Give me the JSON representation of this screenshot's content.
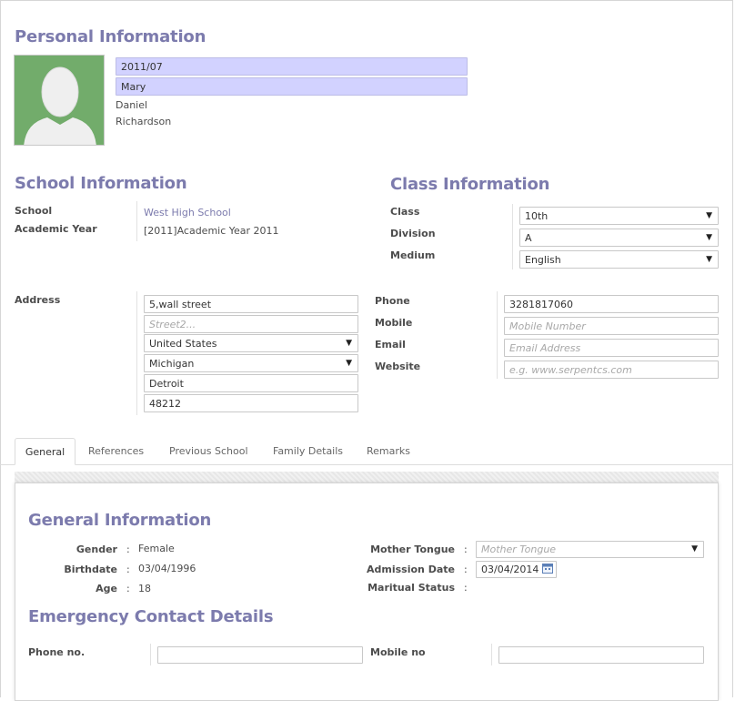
{
  "personal": {
    "title": "Personal Information",
    "photo_icon": "user-avatar-placeholder",
    "student_code": "2011/07",
    "first_name": "Mary",
    "middle_name": "Daniel",
    "last_name": "Richardson"
  },
  "school": {
    "title": "School Information",
    "school_label": "School",
    "school_value": "West High School",
    "year_label": "Academic Year",
    "year_value": "[2011]Academic Year 2011"
  },
  "class_info": {
    "title": "Class Information",
    "class_label": "Class",
    "class_value": "10th",
    "division_label": "Division",
    "division_value": "A",
    "medium_label": "Medium",
    "medium_value": "English"
  },
  "address": {
    "label": "Address",
    "street": "5,wall street",
    "street2_placeholder": "Street2...",
    "country": "United States",
    "state": "Michigan",
    "city": "Detroit",
    "zip": "48212"
  },
  "contact": {
    "phone_label": "Phone",
    "phone_value": "3281817060",
    "mobile_label": "Mobile",
    "mobile_placeholder": "Mobile Number",
    "email_label": "Email",
    "email_placeholder": "Email Address",
    "website_label": "Website",
    "website_placeholder": "e.g. www.serpentcs.com"
  },
  "tabs": [
    {
      "label": "General"
    },
    {
      "label": "References"
    },
    {
      "label": "Previous School"
    },
    {
      "label": "Family Details"
    },
    {
      "label": "Remarks"
    }
  ],
  "general": {
    "title": "General Information",
    "gender_label": "Gender",
    "gender_value": "Female",
    "birthdate_label": "Birthdate",
    "birthdate_value": "03/04/1996",
    "age_label": "Age",
    "age_value": "18",
    "mother_tongue_label": "Mother Tongue",
    "mother_tongue_placeholder": "Mother Tongue",
    "admission_label": "Admission Date",
    "admission_value": "03/04/2014",
    "marital_label": "Maritual Status",
    "colon": ":"
  },
  "emergency": {
    "title": "Emergency Contact Details",
    "phone_label": "Phone no.",
    "mobile_label": "Mobile no"
  },
  "colors": {
    "accent": "#7c7bad",
    "required_field": "#d2d2ff",
    "photo_bg": "#72ac6b"
  }
}
